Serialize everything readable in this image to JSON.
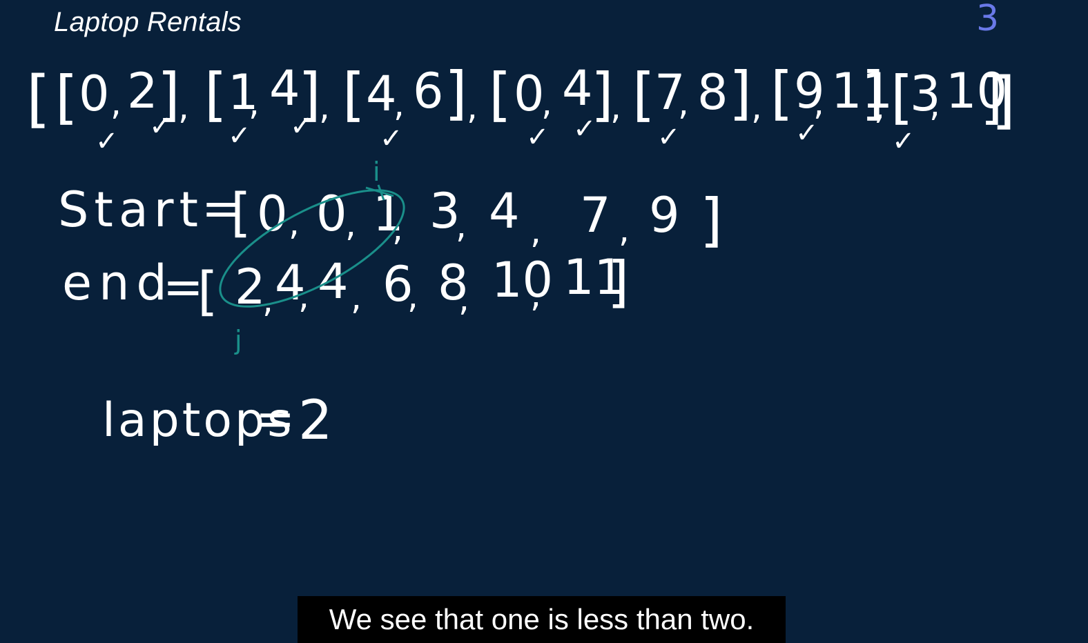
{
  "title": "Laptop Rentals",
  "corner_number": "3",
  "intervals_row": {
    "open": "[",
    "close": "]",
    "separator": ",",
    "items": [
      {
        "a": "0",
        "b": "2"
      },
      {
        "a": "1",
        "b": "4"
      },
      {
        "a": "4",
        "b": "6"
      },
      {
        "a": "0",
        "b": "4"
      },
      {
        "a": "7",
        "b": "8"
      },
      {
        "a": "9",
        "b": "11"
      },
      {
        "a": "3",
        "b": "10"
      }
    ]
  },
  "start_row": {
    "label": "Start",
    "equals": "=",
    "open": "[",
    "close": "]",
    "values": [
      "0",
      "0",
      "1",
      "3",
      "4",
      "7",
      "9"
    ]
  },
  "end_row": {
    "label": "end",
    "equals": "=",
    "open": "[",
    "close": "]",
    "values": [
      "2",
      "4",
      "4",
      "6",
      "8",
      "10",
      "11"
    ]
  },
  "pointers": {
    "i": "i",
    "j": "j"
  },
  "laptops": {
    "label": "laptops",
    "equals": "=",
    "value": "2"
  },
  "checkmark": "✓",
  "caption": "We see that one is less than two.",
  "colors": {
    "background": "#08203a",
    "ink": "#ffffff",
    "teal": "#1a8f8a",
    "corner": "#6a79e8"
  }
}
